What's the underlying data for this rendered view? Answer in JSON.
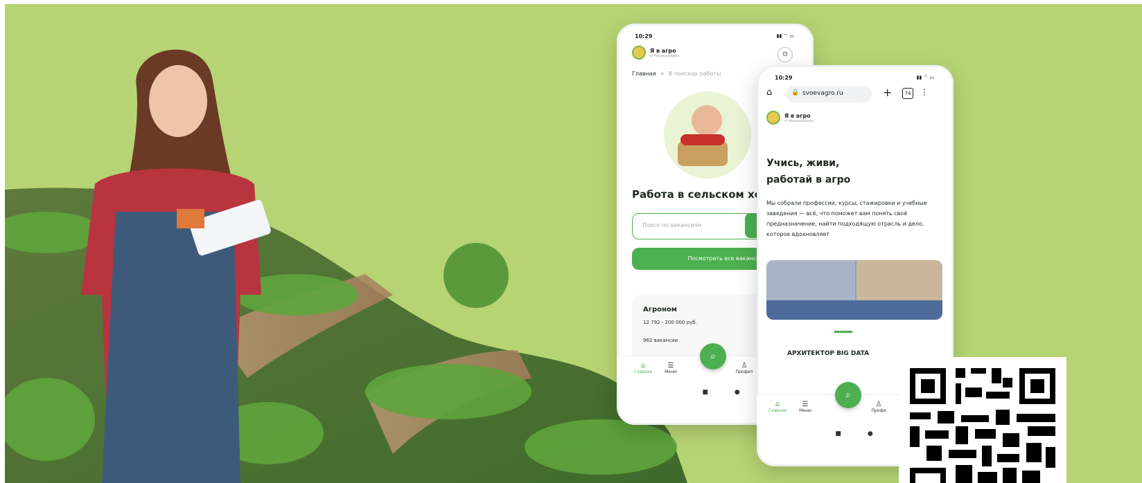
{
  "colors": {
    "banner_bg": "#b7d474",
    "accent_green": "#4caf50",
    "field_green": "#4e8a34"
  },
  "phone_left": {
    "status_time": "10:29",
    "brand_title": "Я в агро",
    "brand_sub": "от Россельхозбанка",
    "breadcrumb_home": "Главная",
    "breadcrumb_current": "В поисках работы",
    "heading": "Работа в сельском хозя",
    "search_placeholder": "Поиск по вакансиям",
    "all_vacancies_button": "Посмотреть все вакансии",
    "card_title": "Агроном",
    "card_salary": "12 792 - 200 000 руб.",
    "card_count": "962 вакансии",
    "nav": {
      "home": "Главная",
      "menu": "Меню",
      "profile": "Профил"
    }
  },
  "phone_right": {
    "status_time": "10:29",
    "url": "svoevagro.ru",
    "tabs_count": "74",
    "brand_title": "Я в агро",
    "brand_sub": "от Россельхозбанка",
    "headline_line1": "Учись, живи,",
    "headline_line2": "работай в агро",
    "description": "Мы собрали профессии, курсы, стажировки и учебные заведения — всё, что поможет вам понять своё предназначение, найти подходящую отрасль и дело, которое вдохновляет",
    "card_title": "АРХИТЕКТОР BIG DATA",
    "nav": {
      "home": "Главная",
      "menu": "Меню",
      "profile": "Профи"
    }
  },
  "icons": [
    "home-icon",
    "menu-icon",
    "search-icon",
    "profile-icon",
    "location-icon",
    "lock-icon",
    "plus-icon",
    "more-icon",
    "qr-code"
  ]
}
